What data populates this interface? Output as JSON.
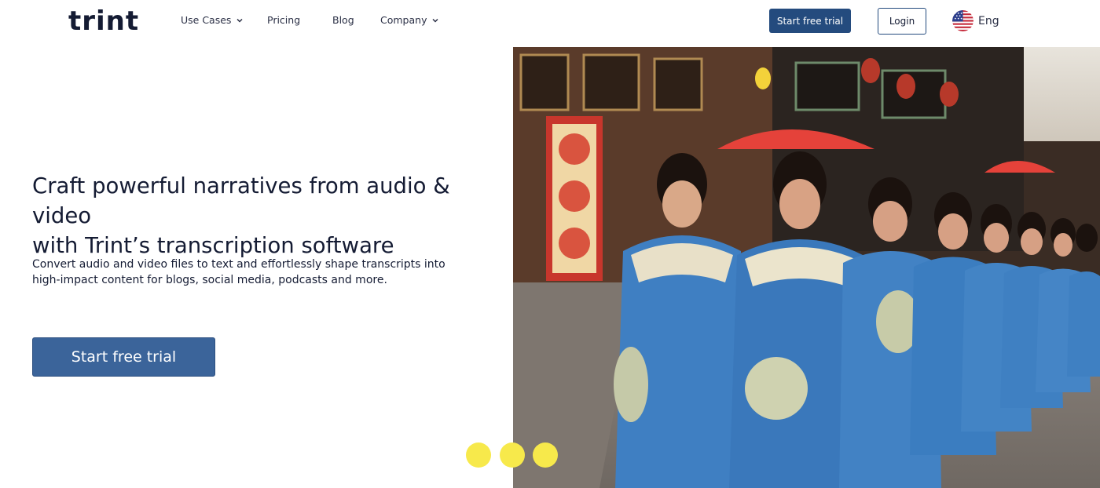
{
  "header": {
    "logo": "trint",
    "nav": [
      {
        "label": "Use Cases",
        "has_dropdown": true
      },
      {
        "label": "Pricing",
        "has_dropdown": false
      },
      {
        "label": "Blog",
        "has_dropdown": false
      },
      {
        "label": "Company",
        "has_dropdown": true
      }
    ],
    "cta_label": "Start free trial",
    "login_label": "Login",
    "language": {
      "label": "Eng",
      "flag_icon": "us-flag-icon"
    }
  },
  "hero": {
    "headline_line1": "Craft powerful narratives from audio & video",
    "headline_line2": "with Trint’s transcription software",
    "subtext": "Convert audio and video files to text and effortlessly shape transcripts into high-impact content for blogs, social media, podcasts and more.",
    "cta_label": "Start free trial"
  },
  "carousel": {
    "dot_count": 3
  },
  "colors": {
    "brand_dark": "#141b33",
    "button_primary": "#244b7e",
    "button_hero": "#3b649a",
    "dot_yellow": "#f7e94b"
  }
}
